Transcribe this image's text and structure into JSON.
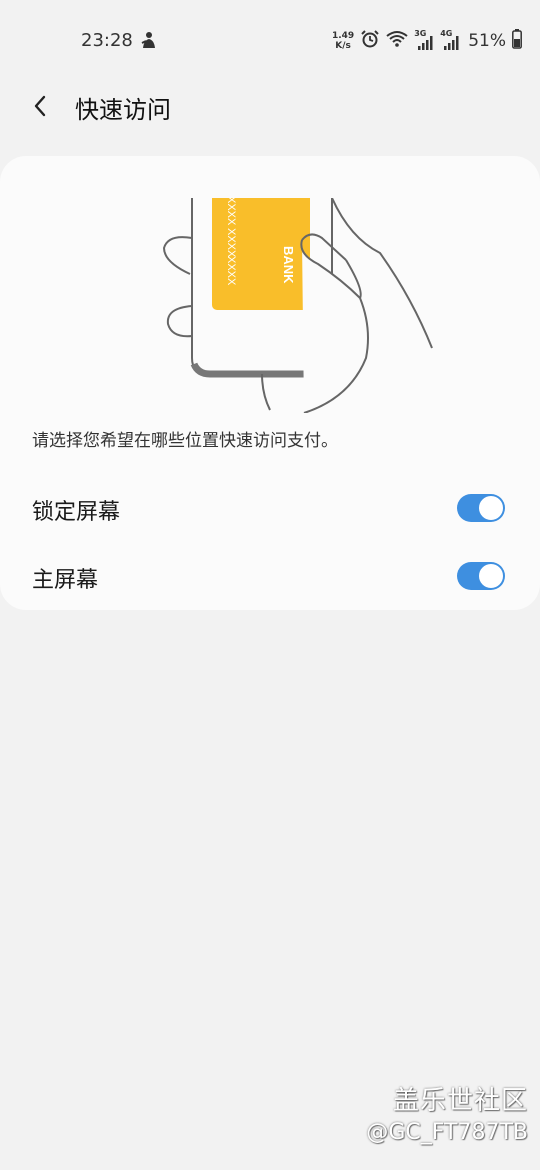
{
  "status_bar": {
    "time": "23:28",
    "net_speed_value": "1.49",
    "net_speed_unit": "K/s",
    "sim1_label": "3G",
    "sim2_label": "4G",
    "battery_percent": "51%",
    "icons": [
      "notification-person-icon",
      "alarm-icon",
      "wifi-icon",
      "signal-3g-icon",
      "signal-4g-icon",
      "battery-icon"
    ]
  },
  "app_bar": {
    "title": "快速访问",
    "back_icon": "chevron-left-icon"
  },
  "illustration": {
    "card_brand": "BANK",
    "card_number_group": "XXXX",
    "card_color": "#F9BE2A"
  },
  "content": {
    "description": "请选择您希望在哪些位置快速访问支付。",
    "settings": [
      {
        "label": "锁定屏幕",
        "enabled": true
      },
      {
        "label": "主屏幕",
        "enabled": true
      }
    ]
  },
  "colors": {
    "accent": "#3E8FE0",
    "background": "#F2F2F2",
    "card": "#FBFBFB"
  },
  "watermark": {
    "line1": "盖乐世社区",
    "line2": "@GC_FT787TB"
  }
}
